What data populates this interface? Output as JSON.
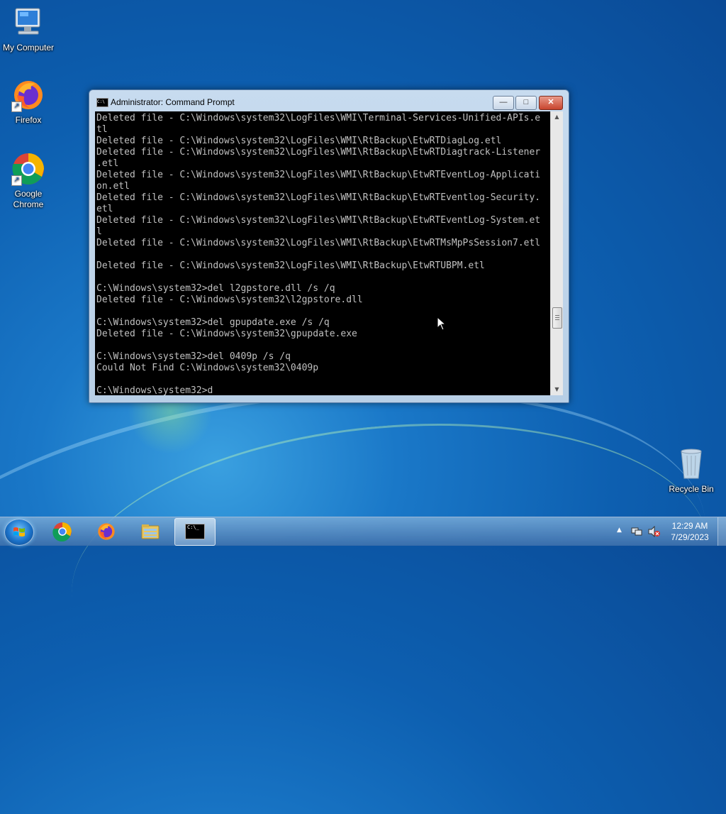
{
  "desktop": {
    "icons": [
      {
        "label": "My Computer"
      },
      {
        "label": "Firefox"
      },
      {
        "label": "Google Chrome"
      },
      {
        "label": "Recycle Bin"
      }
    ]
  },
  "window": {
    "title": "Administrator:  Command Prompt",
    "icon_text": "C:\\",
    "buttons": {
      "minimize": "—",
      "maximize": "□",
      "close": "✕"
    },
    "console_lines": [
      "Deleted file - C:\\Windows\\system32\\LogFiles\\WMI\\Terminal-Services-Unified-APIs.e",
      "tl",
      "Deleted file - C:\\Windows\\system32\\LogFiles\\WMI\\RtBackup\\EtwRTDiagLog.etl",
      "Deleted file - C:\\Windows\\system32\\LogFiles\\WMI\\RtBackup\\EtwRTDiagtrack-Listener",
      ".etl",
      "Deleted file - C:\\Windows\\system32\\LogFiles\\WMI\\RtBackup\\EtwRTEventLog-Applicati",
      "on.etl",
      "Deleted file - C:\\Windows\\system32\\LogFiles\\WMI\\RtBackup\\EtwRTEventlog-Security.",
      "etl",
      "Deleted file - C:\\Windows\\system32\\LogFiles\\WMI\\RtBackup\\EtwRTEventLog-System.et",
      "l",
      "Deleted file - C:\\Windows\\system32\\LogFiles\\WMI\\RtBackup\\EtwRTMsMpPsSession7.etl",
      "",
      "Deleted file - C:\\Windows\\system32\\LogFiles\\WMI\\RtBackup\\EtwRTUBPM.etl",
      "",
      "C:\\Windows\\system32>del l2gpstore.dll /s /q",
      "Deleted file - C:\\Windows\\system32\\l2gpstore.dll",
      "",
      "C:\\Windows\\system32>del gpupdate.exe /s /q",
      "Deleted file - C:\\Windows\\system32\\gpupdate.exe",
      "",
      "C:\\Windows\\system32>del 0409p /s /q",
      "Could Not Find C:\\Windows\\system32\\0409p",
      "",
      "C:\\Windows\\system32>d"
    ]
  },
  "taskbar": {
    "items": [
      "start-button",
      "chrome-icon",
      "firefox-icon",
      "file-explorer-icon",
      "command-prompt-icon"
    ],
    "cmd_icon_text": "C:\\_",
    "clock": {
      "time": "12:29 AM",
      "date": "7/29/2023"
    }
  }
}
